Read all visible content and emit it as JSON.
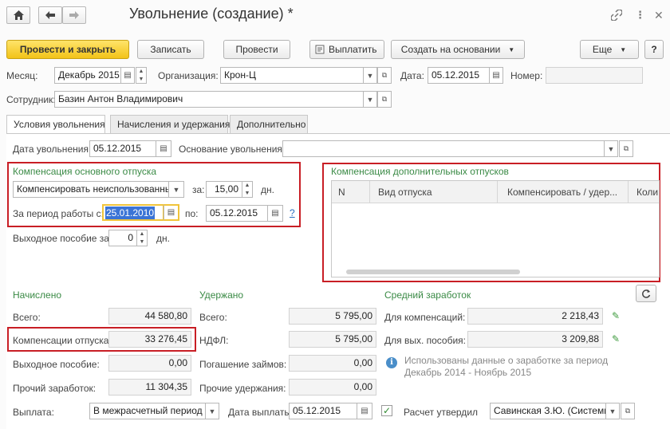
{
  "window": {
    "title": "Увольнение (создание) *",
    "modified_marker": "",
    "icons": {
      "home": "home-icon",
      "back": "arrow-left-icon",
      "forward": "arrow-right-icon",
      "link": "link-icon",
      "menu": "more-vertical-icon",
      "close": "close-icon"
    }
  },
  "toolbar": {
    "post_and_close": "Провести и закрыть",
    "save": "Записать",
    "post": "Провести",
    "pay": "Выплатить",
    "create_based_on": "Создать на основании",
    "more": "Еще",
    "help": "?"
  },
  "header": {
    "month_label": "Месяц:",
    "month_value": "Декабрь 2015",
    "org_label": "Организация:",
    "org_value": "Крон-Ц",
    "date_label": "Дата:",
    "date_value": "05.12.2015",
    "number_label": "Номер:",
    "number_value": "",
    "employee_label": "Сотрудник:",
    "employee_value": "Базин Антон Владимирович"
  },
  "tabs": [
    {
      "label": "Условия увольнения",
      "active": true
    },
    {
      "label": "Начисления и удержания",
      "active": false
    },
    {
      "label": "Дополнительно",
      "active": false
    }
  ],
  "dismissal": {
    "date_label": "Дата увольнения:",
    "date_value": "05.12.2015",
    "reason_label": "Основание увольнения:",
    "reason_value": ""
  },
  "main_leave": {
    "title": "Компенсация основного отпуска",
    "mode_value": "Компенсировать неиспользованный",
    "for_label": "за:",
    "days_value": "15,00",
    "days_unit": "дн.",
    "period_label": "За период работы с:",
    "period_from": "25.01.2010",
    "to_label": "по:",
    "period_to": "05.12.2015",
    "help": "?"
  },
  "severance": {
    "label": "Выходное пособие за:",
    "value": "0",
    "unit": "дн."
  },
  "extra_leave": {
    "title": "Компенсация дополнительных отпусков",
    "columns": [
      "N",
      "Вид отпуска",
      "Компенсировать / удер...",
      "Коли"
    ]
  },
  "accrued": {
    "title": "Начислено",
    "total_label": "Всего:",
    "total_value": "44 580,80",
    "compensation_label": "Компенсации отпуска:",
    "compensation_value": "33 276,45",
    "severance_label": "Выходное пособие:",
    "severance_value": "0,00",
    "other_label": "Прочий заработок:",
    "other_value": "11 304,35"
  },
  "withheld": {
    "title": "Удержано",
    "total_label": "Всего:",
    "total_value": "5 795,00",
    "ndfl_label": "НДФЛ:",
    "ndfl_value": "5 795,00",
    "loans_label": "Погашение займов:",
    "loans_value": "0,00",
    "other_label": "Прочие удержания:",
    "other_value": "0,00"
  },
  "average": {
    "title": "Средний заработок",
    "comp_label": "Для компенсаций:",
    "comp_value": "2 218,43",
    "sev_label": "Для вых. пособия:",
    "sev_value": "3 209,88",
    "info_line1": "Использованы данные о заработке за период",
    "info_line2": "Декабрь 2014 - Ноябрь 2015"
  },
  "payment": {
    "label": "Выплата:",
    "value": "В межрасчетный период",
    "date_label": "Дата выплаты:",
    "date_value": "05.12.2015",
    "approved_label": "Расчет утвердил",
    "approved_value": "Савинская З.Ю. (Системн",
    "approved_checked": true
  },
  "colors": {
    "primary_button": "#f2c318",
    "group_title": "#3a8a45",
    "highlight_box": "#c81e25",
    "selection": "#3b74d6"
  }
}
